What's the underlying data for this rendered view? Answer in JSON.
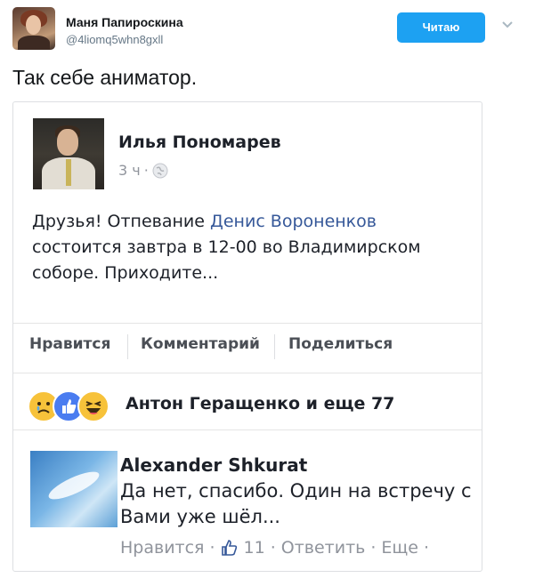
{
  "tweet": {
    "author_name": "Маня Папироскина",
    "author_handle": "@4liomq5whn8gxll",
    "follow_label": "Читаю",
    "text": "Так себе аниматор."
  },
  "fb_post": {
    "author": "Илья Пономарев",
    "time": "3 ч",
    "text_before": "Друзья! Отпевание ",
    "link_text": "Денис Вороненков",
    "text_after": " состоится завтра в 12-00 во Владимирском соборе. Приходите...",
    "actions": {
      "like": "Нравится",
      "comment": "Комментарий",
      "share": "Поделиться"
    },
    "reactions": {
      "icons": [
        "sad-icon",
        "like-icon",
        "haha-icon"
      ],
      "summary": "Антон Геращенко и еще 77"
    }
  },
  "comment": {
    "author": "Alexander Shkurat",
    "text": "Да нет, спасибо. Один на встречу с Вами уже шёл...",
    "like_label": "Нравится",
    "like_count": "11",
    "reply_label": "Ответить",
    "more_label": "Еще"
  },
  "colors": {
    "follow_button": "#1da1f2",
    "fb_link": "#365899",
    "fb_meta_gray": "#90949c"
  }
}
